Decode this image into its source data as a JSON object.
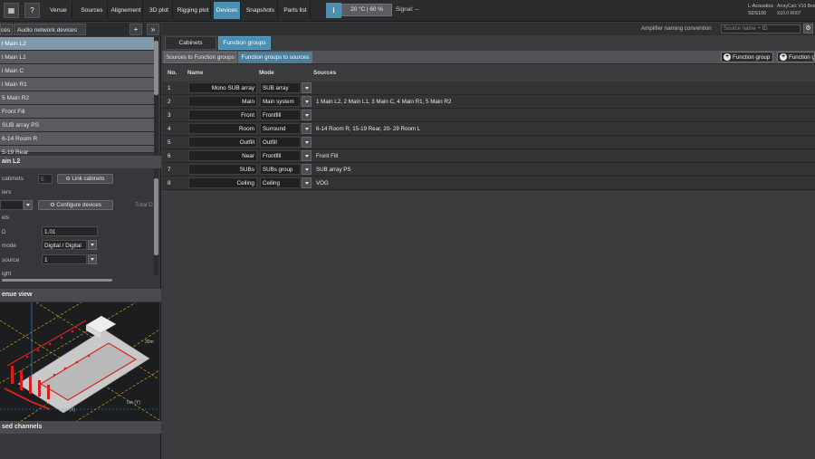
{
  "toolbar": {
    "venue": "Venue",
    "sources": "Sources",
    "alignment": "Alignement",
    "plot3d": "3D plot",
    "rigging": "Rigging plot",
    "devices": "Devices",
    "snapshots": "Snapshots",
    "parts": "Parts list",
    "help_glyph": "?",
    "info_glyph": "i",
    "temperature": "20 °C | 60 %",
    "signal": "Signal: --",
    "logo_top": "L-Acoustics",
    "logo_bottom": "SDS100",
    "build_top": "ArrayCalc V10 Beta",
    "build_bottom": "X10.0 R007"
  },
  "left": {
    "tab_sources": "ces",
    "tab_audio_network": "Audio network devices",
    "add_glyph": "+",
    "collapse_glyph": "»",
    "sources": [
      {
        "label": "l Main L2",
        "selected": true
      },
      {
        "label": "l Main L1",
        "selected": false
      },
      {
        "label": "l Main C",
        "selected": false
      },
      {
        "label": "l Main R1",
        "selected": false
      },
      {
        "label": "5 Main R2",
        "selected": false
      },
      {
        "label": "Front Fill",
        "selected": false
      },
      {
        "label": "SUB array PS",
        "selected": false
      },
      {
        "label": "6-14 Room R",
        "selected": false
      },
      {
        "label": "5-19 Rear",
        "selected": false
      }
    ],
    "props_title": "ain L2",
    "cabinets_label": "cabinets",
    "cabinets_value": "5",
    "link_cabinets": "Link cabinets",
    "amplifiers_label": "iers",
    "configure_devices": "Configure devices",
    "total_label": "Total D",
    "channels_label": "els",
    "field_id_label": "D",
    "field_id_value": "1.01",
    "mode_label": "mode",
    "mode_value": "Digital / Digital",
    "source_label": "source",
    "source_value": "1",
    "weight_label": "ight",
    "venue_view_title": "enue view",
    "grid_10m": "10m",
    "grid_20m": "20m",
    "grid_30m": "30m",
    "grid_0m_x": "0m (X)",
    "grid_0m_y": "0m (Y)",
    "used_channels_title": "sed channels"
  },
  "main": {
    "amp_naming_label": "Amplifier naming convention",
    "amp_naming_placeholder": "Source name + ID",
    "tab_cabinets": "Cabinets",
    "tab_function_groups": "Function groups",
    "subtab_sources_to_fg": "Sources to Function groups",
    "subtab_fg_to_sources": "Function groups to sources",
    "btn_function_group": "Function group",
    "btn_function_group_2": "Function g",
    "plus_glyph": "+",
    "columns": {
      "no": "No.",
      "name": "Name",
      "mode": "Mode",
      "sources": "Sources"
    },
    "rows": [
      {
        "no": "1",
        "name": "Mono SUB array",
        "mode": "SUB array",
        "sources": ""
      },
      {
        "no": "2",
        "name": "Main",
        "mode": "Main system",
        "sources": "1 Main L2, 2 Main L1, 3 Main C, 4 Main R1, 5 Main R2"
      },
      {
        "no": "3",
        "name": "Front",
        "mode": "Frontfill",
        "sources": ""
      },
      {
        "no": "4",
        "name": "Room",
        "mode": "Surround",
        "sources": "6-14 Room R, 15-19 Rear, 20- 29 Room L"
      },
      {
        "no": "5",
        "name": "Outfill",
        "mode": "Outfill",
        "sources": ""
      },
      {
        "no": "6",
        "name": "Near",
        "mode": "Frontfill",
        "sources": "Front Fill"
      },
      {
        "no": "7",
        "name": "SUBs",
        "mode": "SUBs group",
        "sources": "SUB array PS"
      },
      {
        "no": "8",
        "name": "Ceiling",
        "mode": "Ceiling",
        "sources": "VOG"
      }
    ]
  },
  "colors": {
    "accent": "#4b8fb3",
    "selected_row": "#7f98aa",
    "venue_red": "#d62020",
    "venue_grid": "#c8a21a"
  }
}
